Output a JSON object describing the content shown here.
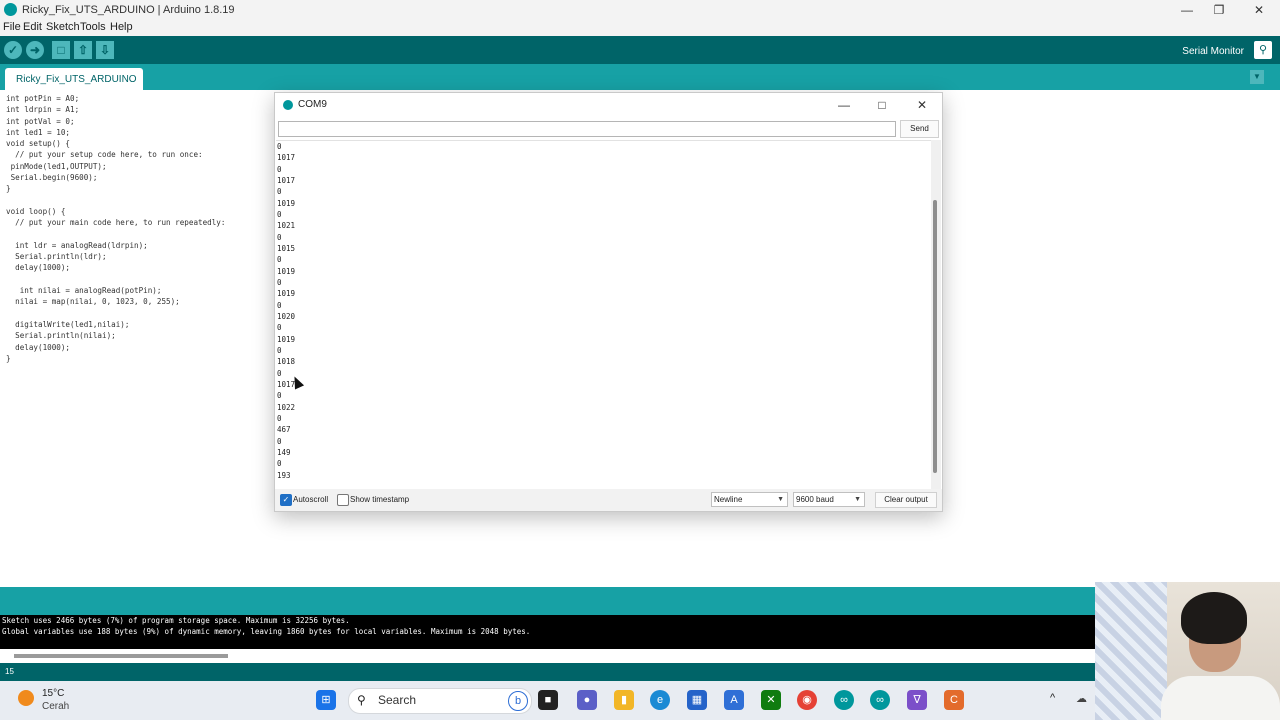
{
  "window": {
    "title": "Ricky_Fix_UTS_ARDUINO | Arduino 1.8.19"
  },
  "menu": [
    "File",
    "Edit",
    "Sketch",
    "Tools",
    "Help"
  ],
  "toolbar": {
    "serial_monitor_label": "Serial Monitor"
  },
  "tab": {
    "label": "Ricky_Fix_UTS_ARDUINO"
  },
  "code": [
    "int potPin = A0;",
    "int ldrpin = A1;",
    "int potVal = 0;",
    "int led1 = 10;",
    "void setup() {",
    "  // put your setup code here, to run once:",
    " pinMode(led1,OUTPUT);",
    " Serial.begin(9600);",
    "}",
    "",
    "void loop() {",
    "  // put your main code here, to run repeatedly:",
    "",
    "  int ldr = analogRead(ldrpin);",
    "  Serial.println(ldr);",
    "  delay(1000);",
    "",
    "   int nilai = analogRead(potPin);",
    "  nilai = map(nilai, 0, 1023, 0, 255);",
    "",
    "  digitalWrite(led1,nilai);",
    "  Serial.println(nilai);",
    "  delay(1000);",
    "}"
  ],
  "console": {
    "line1": "Sketch uses 2466 bytes (7%) of program storage space. Maximum is 32256 bytes.",
    "line2": "Global variables use 188 bytes (9%) of dynamic memory, leaving 1860 bytes for local variables. Maximum is 2048 bytes."
  },
  "status": {
    "line_number": "15"
  },
  "serial_monitor": {
    "title": "COM9",
    "input_value": "",
    "send_label": "Send",
    "output": [
      "0",
      "1017",
      "0",
      "1017",
      "0",
      "1019",
      "0",
      "1021",
      "0",
      "1015",
      "0",
      "1019",
      "0",
      "1019",
      "0",
      "1020",
      "0",
      "1019",
      "0",
      "1018",
      "0",
      "1017",
      "0",
      "1022",
      "0",
      "467",
      "0",
      "149",
      "0",
      "193"
    ],
    "autoscroll_label": "Autoscroll",
    "autoscroll_checked": true,
    "timestamp_label": "Show timestamp",
    "timestamp_checked": false,
    "line_ending": "Newline",
    "baud": "9600 baud",
    "clear_label": "Clear output"
  },
  "taskbar": {
    "weather_temp": "15°C",
    "weather_desc": "Cerah",
    "search_label": "Search"
  },
  "colors": {
    "arduino_dark": "#006468",
    "arduino_teal": "#17a1a5",
    "accent": "#00979c"
  }
}
